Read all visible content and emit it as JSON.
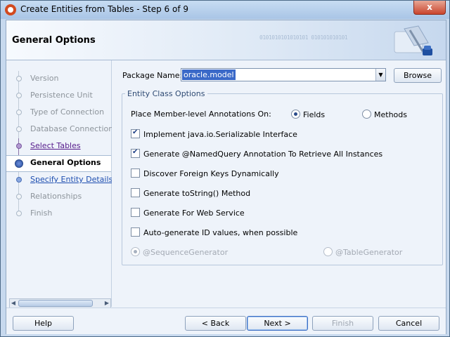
{
  "window": {
    "title": "Create Entities from Tables - Step 6 of 9",
    "close_label": "x"
  },
  "header": {
    "title": "General Options",
    "binary_text": "0101010101010101 010101010101"
  },
  "steps": [
    {
      "label": "Version",
      "state": "disabled"
    },
    {
      "label": "Persistence Unit",
      "state": "disabled"
    },
    {
      "label": "Type of Connection",
      "state": "disabled"
    },
    {
      "label": "Database Connection De",
      "state": "disabled"
    },
    {
      "label": "Select Tables",
      "state": "visited"
    },
    {
      "label": "General Options",
      "state": "current"
    },
    {
      "label": "Specify Entity Details",
      "state": "link"
    },
    {
      "label": "Relationships",
      "state": "disabled"
    },
    {
      "label": "Finish",
      "state": "disabled"
    }
  ],
  "main": {
    "package_label": "Package Name:",
    "package_value": "oracle.model",
    "browse_label": "Browse",
    "group_label": "Entity Class Options",
    "annotations_label": "Place Member-level Annotations On:",
    "annotation_options": [
      {
        "label": "Fields",
        "selected": true
      },
      {
        "label": "Methods",
        "selected": false
      }
    ],
    "checkboxes": [
      {
        "label": "Implement java.io.Serializable Interface",
        "checked": true
      },
      {
        "label": "Generate @NamedQuery Annotation To Retrieve All Instances",
        "checked": true
      },
      {
        "label": "Discover Foreign Keys Dynamically",
        "checked": false
      },
      {
        "label": "Generate toString() Method",
        "checked": false
      },
      {
        "label": "Generate For Web Service",
        "checked": false
      },
      {
        "label": "Auto-generate ID values, when possible",
        "checked": false
      }
    ],
    "generator_options": [
      {
        "label": "@SequenceGenerator",
        "selected": true,
        "enabled": false
      },
      {
        "label": "@TableGenerator",
        "selected": false,
        "enabled": false
      }
    ]
  },
  "footer": {
    "help": "Help",
    "back": "< Back",
    "next": "Next >",
    "finish": "Finish",
    "cancel": "Cancel"
  }
}
